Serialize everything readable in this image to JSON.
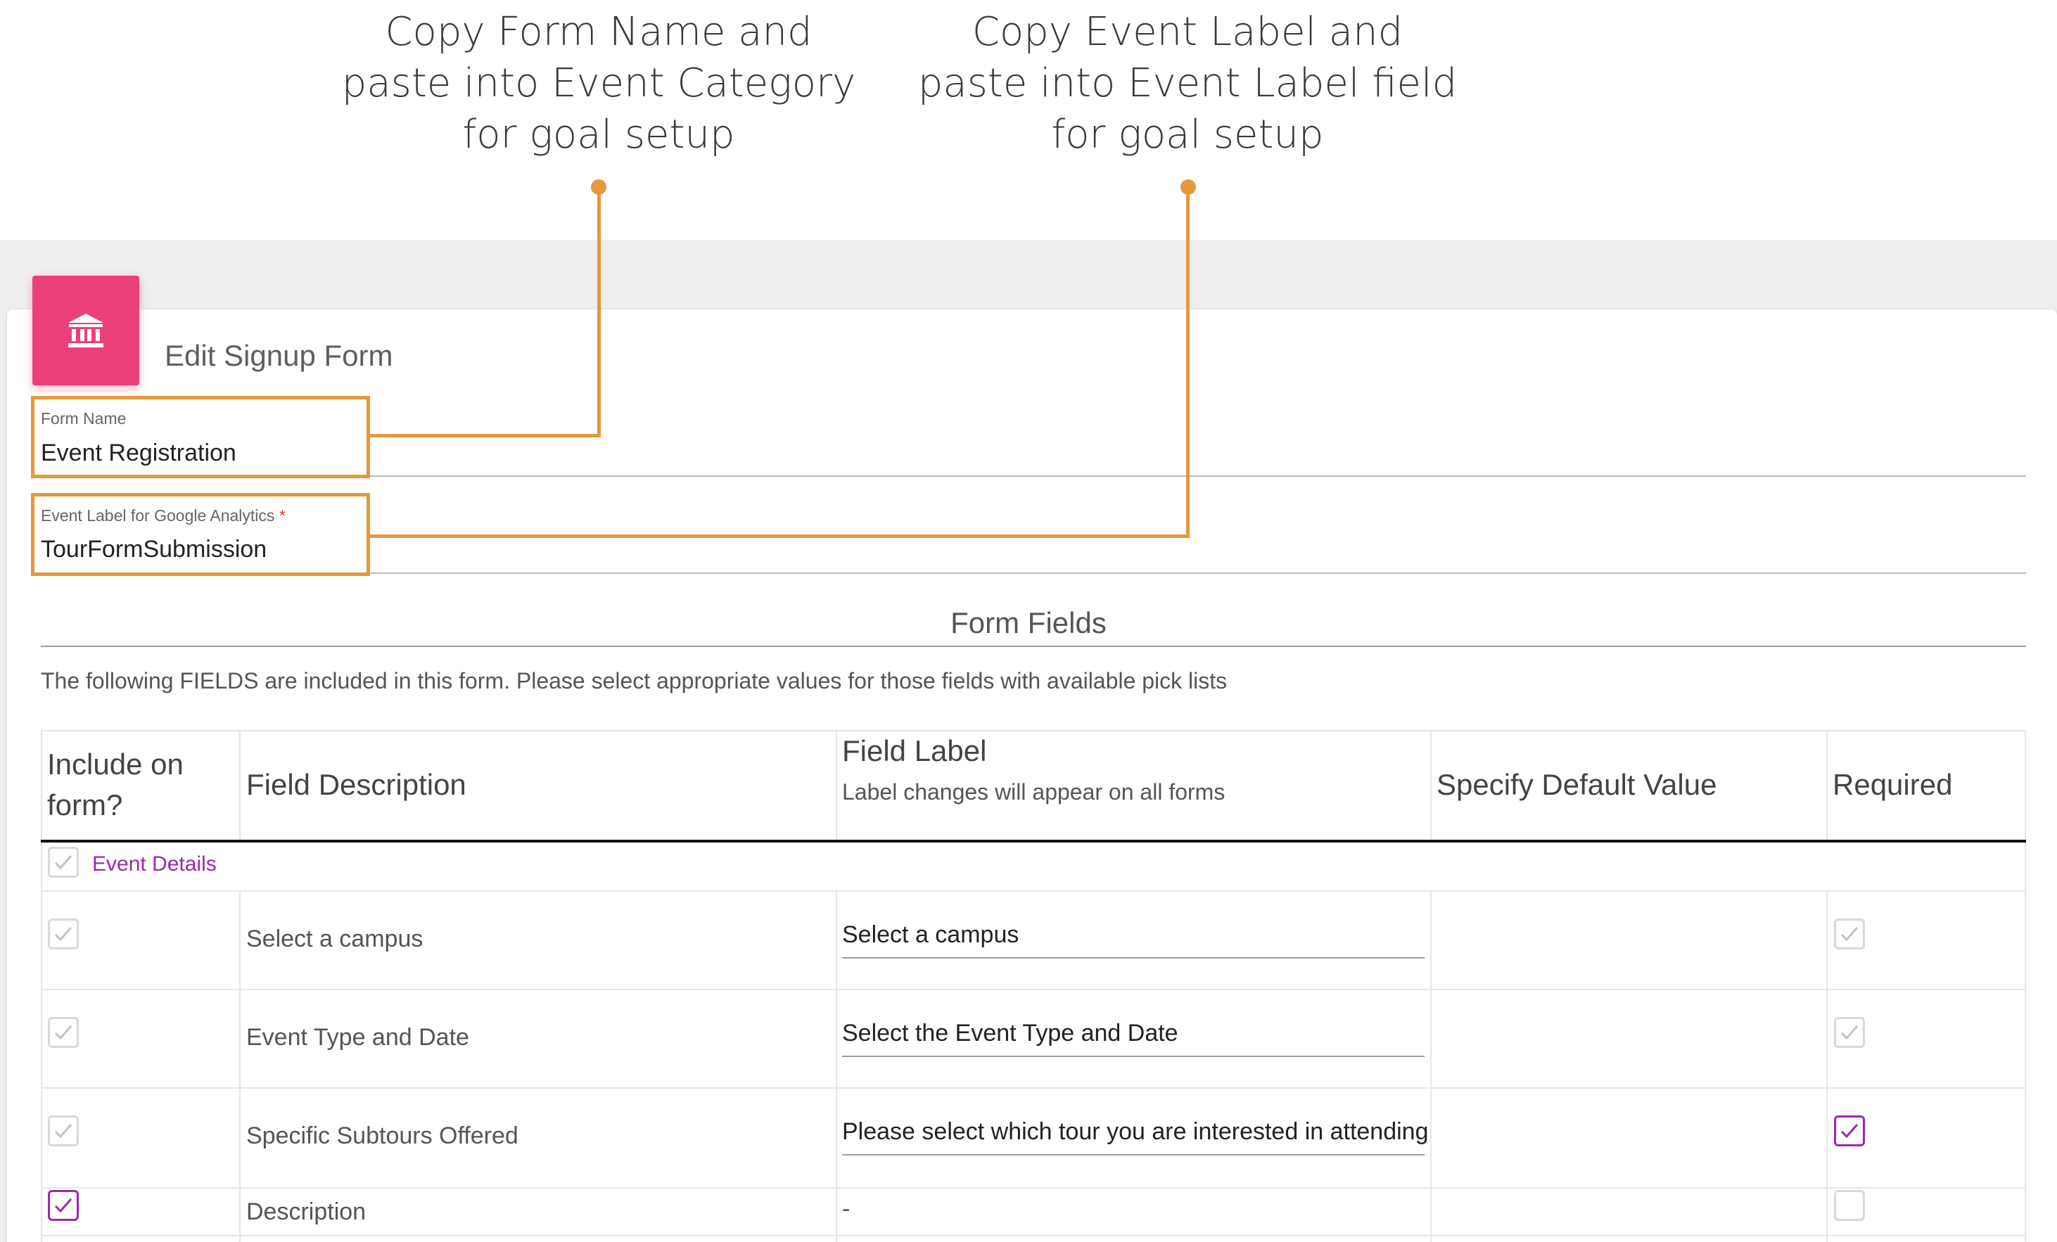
{
  "callouts": {
    "form_name": {
      "line1": "Copy Form Name and",
      "line2": "paste into Event Category",
      "line3": "for goal setup"
    },
    "event_label": {
      "line1": "Copy Event Label and",
      "line2": "paste into Event Label field",
      "line3": "for goal setup"
    }
  },
  "colors": {
    "callout_accent": "#e5983d",
    "brand_icon": "#ec407a",
    "checkbox_checked": "#9c27b0",
    "required_asterisk": "#e53935"
  },
  "header": {
    "icon": "bank-icon",
    "title": "Edit Signup Form"
  },
  "form": {
    "form_name": {
      "label": "Form Name",
      "value": "Event Registration"
    },
    "event_label": {
      "label": "Event Label for Google Analytics",
      "required_marker": "*",
      "value": "TourFormSubmission"
    }
  },
  "fields_section": {
    "title": "Form Fields",
    "description": "The following FIELDS are included in this form. Please select appropriate values for those fields with available pick lists",
    "columns": {
      "include_line1": "Include on",
      "include_line2": "form?",
      "description": "Field Description",
      "label": "Field Label",
      "label_hint": "Label changes will appear on all forms",
      "default": "Specify Default Value",
      "required": "Required"
    },
    "group": {
      "name": "Event Details",
      "checked": true
    },
    "rows": [
      {
        "include": true,
        "description": "Select a campus",
        "label": "Select a campus",
        "required": true
      },
      {
        "include": true,
        "description": "Event Type and Date",
        "label": "Select the Event Type and Date",
        "required": true
      },
      {
        "include": true,
        "description": "Specific Subtours Offered",
        "label": "Please select which tour you are interested in attending",
        "required": true
      },
      {
        "include": true,
        "description": "Description",
        "label": "-",
        "required": false
      }
    ]
  }
}
